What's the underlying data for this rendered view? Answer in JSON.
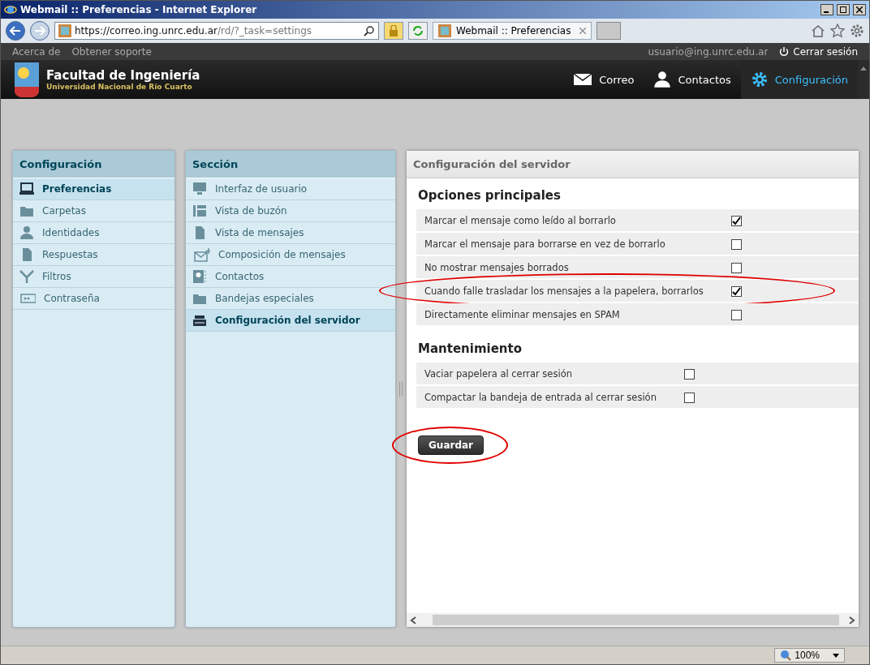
{
  "window": {
    "title": "Webmail :: Preferencias - Internet Explorer"
  },
  "address_bar": {
    "url_parts": [
      "https://correo.ing.",
      "unrc.edu.ar",
      "/rd/?_task=settings"
    ]
  },
  "browser_tab": {
    "title": "Webmail :: Preferencias"
  },
  "top_links": [
    "Acerca de",
    "Obtener soporte"
  ],
  "user": "usuario@ing.unrc.edu.ar",
  "logout": "Cerrar sesión",
  "logo": {
    "title": "Facultad de Ingeniería",
    "subtitle": "Universidad Nacional de Río Cuarto"
  },
  "nav": [
    {
      "label": "Correo",
      "selected": false
    },
    {
      "label": "Contactos",
      "selected": false
    },
    {
      "label": "Configuración",
      "selected": true
    }
  ],
  "settings_panel": {
    "title": "Configuración",
    "items": [
      {
        "label": "Preferencias",
        "selected": true
      },
      {
        "label": "Carpetas",
        "selected": false
      },
      {
        "label": "Identidades",
        "selected": false
      },
      {
        "label": "Respuestas",
        "selected": false
      },
      {
        "label": "Filtros",
        "selected": false
      },
      {
        "label": "Contraseña",
        "selected": false
      }
    ]
  },
  "section_panel": {
    "title": "Sección",
    "items": [
      {
        "label": "Interfaz de usuario",
        "selected": false
      },
      {
        "label": "Vista de buzón",
        "selected": false
      },
      {
        "label": "Vista de mensajes",
        "selected": false
      },
      {
        "label": "Composición de mensajes",
        "selected": false
      },
      {
        "label": "Contactos",
        "selected": false
      },
      {
        "label": "Bandejas especiales",
        "selected": false
      },
      {
        "label": "Configuración del servidor",
        "selected": true
      }
    ]
  },
  "content": {
    "title": "Configuración del servidor",
    "sections": [
      {
        "heading": "Opciones principales",
        "options": [
          {
            "label": "Marcar el mensaje como leído al borrarlo",
            "checked": true,
            "circled": false
          },
          {
            "label": "Marcar el mensaje para borrarse en vez de borrarlo",
            "checked": false,
            "circled": false
          },
          {
            "label": "No mostrar mensajes borrados",
            "checked": false,
            "circled": false
          },
          {
            "label": "Cuando falle trasladar los mensajes a la papelera, borrarlos",
            "checked": true,
            "circled": true
          },
          {
            "label": "Directamente eliminar mensajes en SPAM",
            "checked": false,
            "circled": false
          }
        ]
      },
      {
        "heading": "Mantenimiento",
        "options": [
          {
            "label": "Vaciar papelera al cerrar sesión",
            "checked": false,
            "circled": false
          },
          {
            "label": "Compactar la bandeja de entrada al cerrar sesión",
            "checked": false,
            "circled": false
          }
        ]
      }
    ],
    "save_button": {
      "label": "Guardar",
      "circled": true
    }
  },
  "status_bar": {
    "zoom": "100%"
  }
}
